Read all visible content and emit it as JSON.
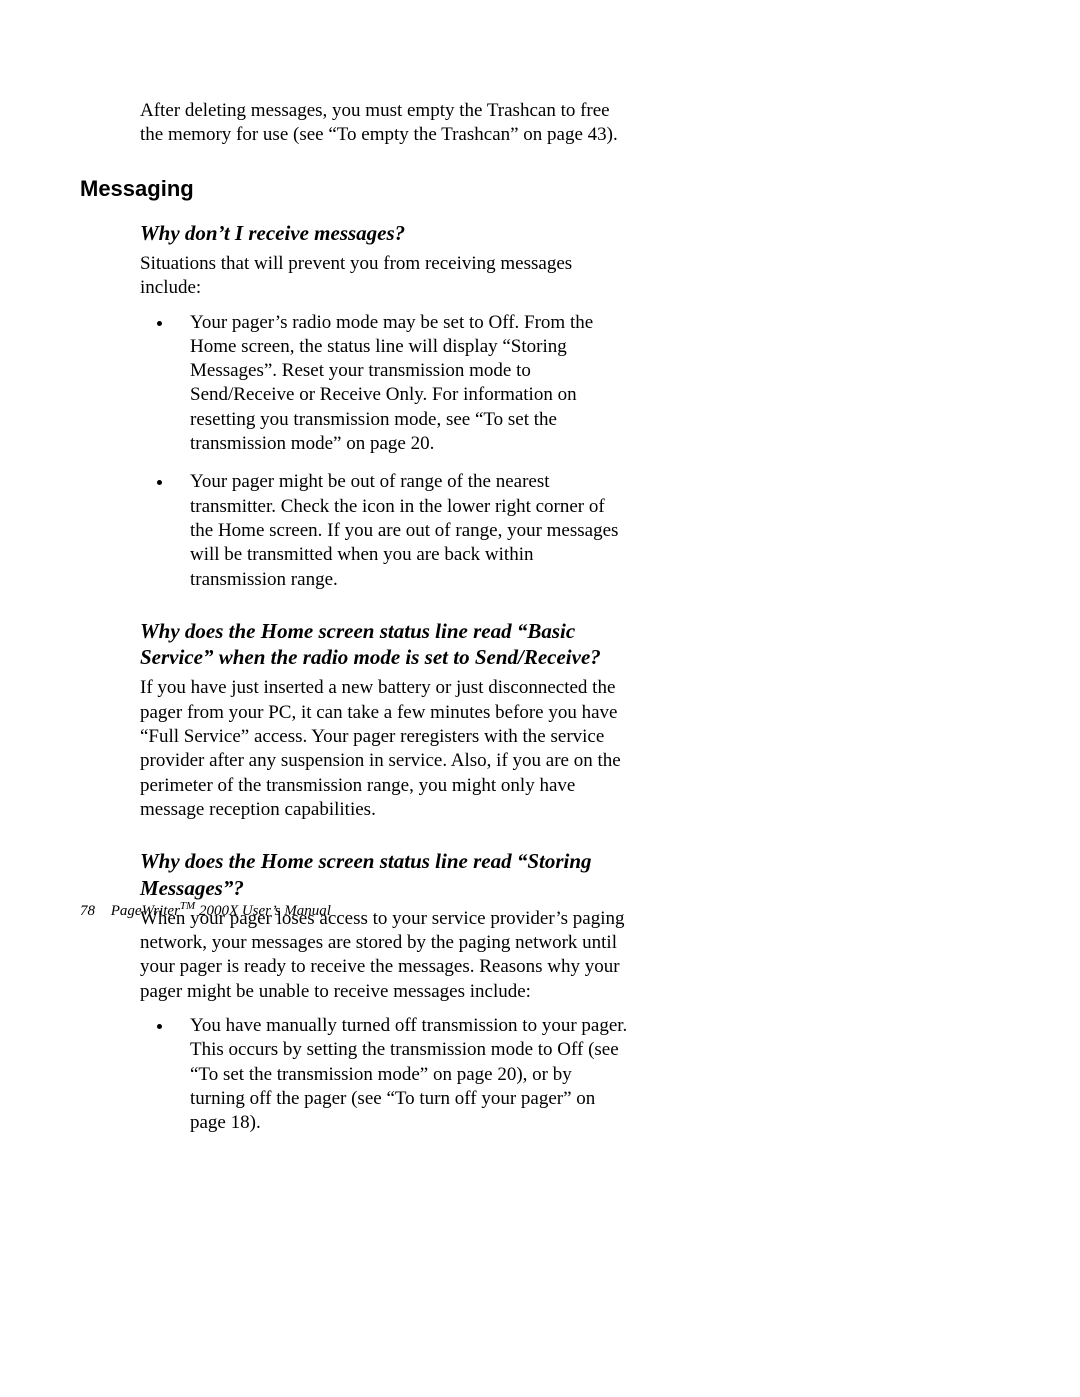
{
  "intro": "After deleting messages, you must empty the Trashcan to free the memory for use (see “To empty the Trashcan” on page 43).",
  "section_heading": "Messaging",
  "qa1": {
    "question": "Why don’t I receive messages?",
    "answer": "Situations that will prevent you from receiving messages include:",
    "bullets": [
      "Your pager’s radio mode may be set to Off. From the Home screen, the status line will display “Storing Messages”. Reset your transmission mode to Send/Receive or Receive Only. For information on resetting you transmission mode, see “To set the transmission mode” on page 20.",
      "Your pager might be out of range of the nearest transmitter. Check the icon in the lower right corner of the Home screen. If you are out of range, your messages will be transmitted when you are back within transmission range."
    ]
  },
  "qa2": {
    "question": "Why does the Home screen status line read “Basic Service” when the radio mode is set to Send/Receive?",
    "answer": "If you have just inserted a new battery or just disconnected the pager from your PC, it can take a few minutes before you have “Full Service” access. Your pager reregisters with the service provider after any suspension in service. Also, if you are on the perimeter of the transmission range, you might only have message reception capabilities."
  },
  "qa3": {
    "question": "Why does the Home screen status line read “Storing Messages”?",
    "answer": "When your pager loses access to your service provider’s paging network, your messages are stored by the paging network until your pager is ready to receive the messages. Reasons why your pager might be unable to receive messages include:",
    "bullets": [
      "You have manually turned off transmission to your pager. This occurs by setting the transmission mode to Off (see “To set the transmission mode” on page 20), or by turning off the pager (see “To turn off your pager” on page 18)."
    ]
  },
  "footer": {
    "page_number": "78",
    "product_prefix": "PageWriter",
    "tm": "TM",
    "product_suffix": " 2000X User’s Manual"
  }
}
